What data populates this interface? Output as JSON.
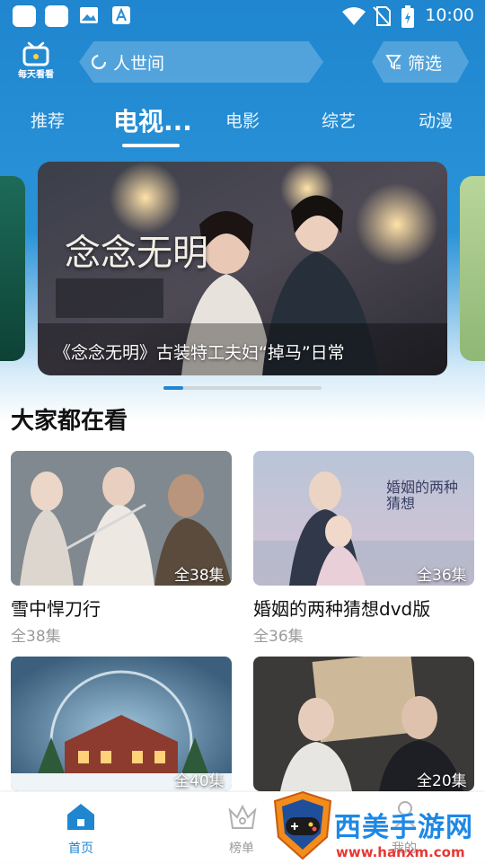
{
  "status_bar": {
    "time": "10:00"
  },
  "header": {
    "logo_text": "每天看看",
    "search_text": "人世间",
    "filter_label": "筛选"
  },
  "tabs": [
    {
      "label": "推荐"
    },
    {
      "label": "电视..."
    },
    {
      "label": "电影"
    },
    {
      "label": "综艺"
    },
    {
      "label": "动漫"
    }
  ],
  "banner": {
    "title": "《念念无明》古装特工夫妇“掉马”日常",
    "poster_logo": "念念无明",
    "pager": {
      "current": 1,
      "fraction": 0.125
    }
  },
  "section": {
    "title": "大家都在看",
    "items": [
      {
        "title": "雪中悍刀行",
        "badge": "全38集",
        "subtitle": "全38集"
      },
      {
        "title": "婚姻的两种猜想dvd版",
        "badge": "全36集",
        "subtitle": "全36集",
        "poster_logo": "婚姻的两种猜想"
      },
      {
        "title": "",
        "badge": "全40集",
        "subtitle": ""
      },
      {
        "title": "",
        "badge": "全20集",
        "subtitle": ""
      }
    ]
  },
  "bottom_nav": [
    {
      "label": "首页",
      "icon": "home-icon",
      "active": true
    },
    {
      "label": "榜单",
      "icon": "crown-icon",
      "active": false
    },
    {
      "label": "我的",
      "icon": "user-icon",
      "active": false
    }
  ],
  "watermark": {
    "text": "西美手游网",
    "url": "www.hanxm.com"
  },
  "colors": {
    "brand": "#1f86cf",
    "active_nav": "#1f86cf",
    "inactive_nav": "#9a9a9a"
  }
}
